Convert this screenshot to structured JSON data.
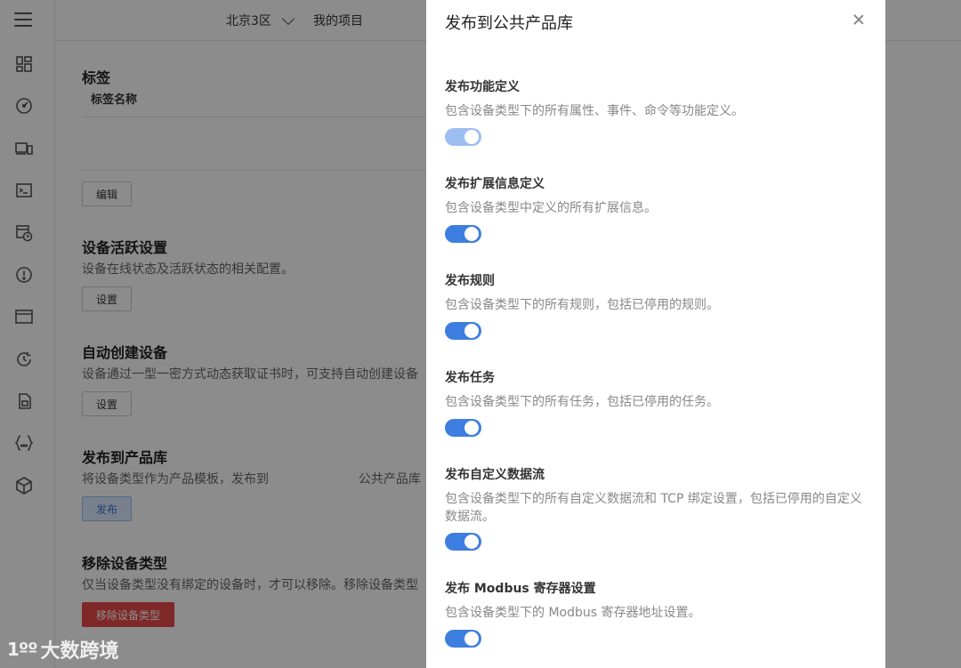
{
  "header": {
    "region": "北京3区",
    "project": "我的项目"
  },
  "rail": {
    "icons": [
      "dashboard-icon",
      "speedometer-icon",
      "devices-icon",
      "terminal-icon",
      "schedule-icon",
      "alert-icon",
      "window-icon",
      "history-icon",
      "sim-card-icon",
      "code-braces-icon",
      "package-icon"
    ]
  },
  "main": {
    "tags": {
      "title": "标签",
      "column": "标签名称",
      "edit_button": "编辑"
    },
    "activity": {
      "title": "设备活跃设置",
      "desc": "设备在线状态及活跃状态的相关配置。",
      "button": "设置"
    },
    "autocreate": {
      "title": "自动创建设备",
      "desc": "设备通过一型一密方式动态获取证书时，可支持自动创建设备",
      "button": "设置"
    },
    "publish": {
      "title": "发布到产品库",
      "desc_part1": "将设备类型作为产品模板，发布到",
      "desc_part2": "公共产品库",
      "button": "发布"
    },
    "remove": {
      "title": "移除设备类型",
      "desc": "仅当设备类型没有绑定的设备时，才可以移除。移除设备类型",
      "button": "移除设备类型"
    }
  },
  "drawer": {
    "title": "发布到公共产品库",
    "options": [
      {
        "title": "发布功能定义",
        "desc": "包含设备类型下的所有属性、事件、命令等功能定义。",
        "enabled": true,
        "disabled": true
      },
      {
        "title": "发布扩展信息定义",
        "desc": "包含设备类型中定义的所有扩展信息。",
        "enabled": true,
        "disabled": false
      },
      {
        "title": "发布规则",
        "desc": "包含设备类型下的所有规则，包括已停用的规则。",
        "enabled": true,
        "disabled": false
      },
      {
        "title": "发布任务",
        "desc": "包含设备类型下的所有任务，包括已停用的任务。",
        "enabled": true,
        "disabled": false
      },
      {
        "title": "发布自定义数据流",
        "desc": "包含设备类型下的所有自定义数据流和 TCP 绑定设置，包括已停用的自定义数据流。",
        "enabled": true,
        "disabled": false
      },
      {
        "title": "发布 Modbus 寄存器设置",
        "desc": "包含设备类型下的 Modbus 寄存器地址设置。",
        "enabled": true,
        "disabled": false
      }
    ]
  },
  "watermark": {
    "logo": "1ºº",
    "text": "大数跨境"
  },
  "colors": {
    "accent": "#3d7ee0",
    "danger": "#e84a4a"
  }
}
